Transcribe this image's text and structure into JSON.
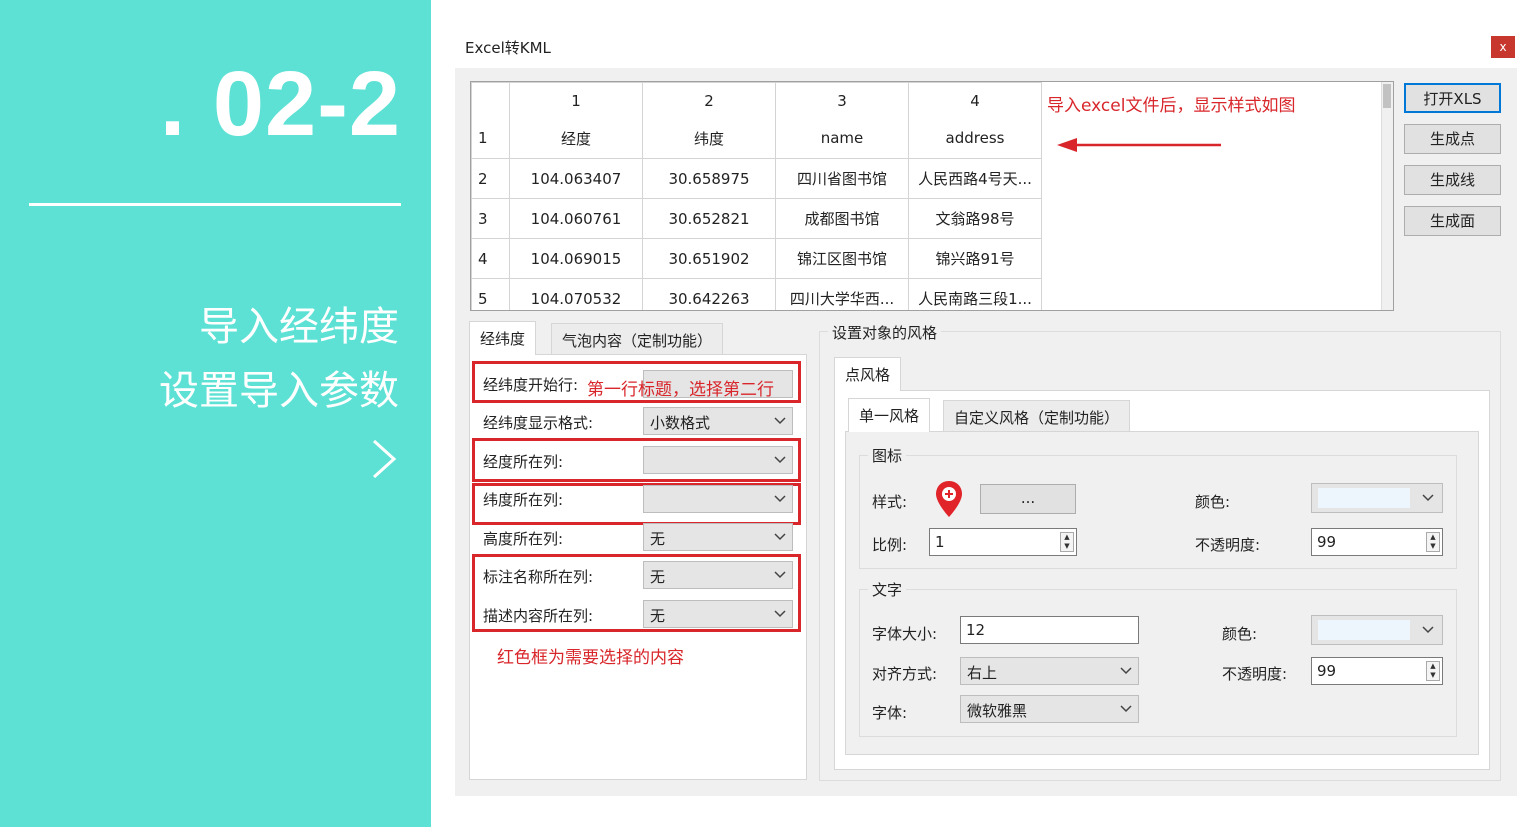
{
  "slide": {
    "number": ". 02-2",
    "line1": "导入经纬度",
    "line2": "设置导入参数",
    "next_icon": "chevron-right-icon"
  },
  "window": {
    "title": "Excel转KML",
    "close_label": "x"
  },
  "grid": {
    "col_numbers": [
      "1",
      "2",
      "3",
      "4"
    ],
    "rows": [
      {
        "row": "1",
        "cells": [
          "经度",
          "纬度",
          "name",
          "address"
        ]
      },
      {
        "row": "2",
        "cells": [
          "104.063407",
          "30.658975",
          "四川省图书馆",
          "人民西路4号天..."
        ]
      },
      {
        "row": "3",
        "cells": [
          "104.060761",
          "30.652821",
          "成都图书馆",
          "文翁路98号"
        ]
      },
      {
        "row": "4",
        "cells": [
          "104.069015",
          "30.651902",
          "锦江区图书馆",
          "锦兴路91号"
        ]
      },
      {
        "row": "5",
        "cells": [
          "104.070532",
          "30.642263",
          "四川大学华西...",
          "人民南路三段1..."
        ]
      }
    ]
  },
  "annotations": {
    "import_note": "导入excel文件后，显示样式如图",
    "start_row_note": "第一行标题，选择第二行",
    "red_box_note": "红色框为需要选择的内容"
  },
  "buttons": {
    "open_xls": "打开XLS",
    "gen_point": "生成点",
    "gen_line": "生成线",
    "gen_polygon": "生成面"
  },
  "left_tabs": [
    "经纬度",
    "气泡内容（定制功能）"
  ],
  "left_form": {
    "start_row_label": "经纬度开始行:",
    "format_label": "经纬度显示格式:",
    "format_value": "小数格式",
    "lon_col_label": "经度所在列:",
    "lon_col_value": "",
    "lat_col_label": "纬度所在列:",
    "lat_col_value": "",
    "alt_col_label": "高度所在列:",
    "alt_col_value": "无",
    "name_col_label": "标注名称所在列:",
    "name_col_value": "无",
    "desc_col_label": "描述内容所在列:",
    "desc_col_value": "无"
  },
  "style": {
    "group_title": "设置对象的风格",
    "point_tab": "点风格",
    "inner_tabs": [
      "单一风格",
      "自定义风格（定制功能）"
    ],
    "icon_group": "图标",
    "style_label": "样式:",
    "browse_label": "...",
    "color_label": "颜色:",
    "scale_label": "比例:",
    "scale_value": "1",
    "opacity_label": "不透明度:",
    "opacity_value": "99",
    "text_group": "文字",
    "font_size_label": "字体大小:",
    "font_size_value": "12",
    "text_color_label": "颜色:",
    "align_label": "对齐方式:",
    "align_value": "右上",
    "text_opacity_label": "不透明度:",
    "text_opacity_value": "99",
    "font_label": "字体:",
    "font_value": "微软雅黑",
    "marker_icon": "map-pin-icon",
    "marker_color": "#e0242a"
  },
  "colors": {
    "accent": "#5de1d5",
    "annotation_red": "#d8262b",
    "focus_blue": "#0078d7"
  }
}
